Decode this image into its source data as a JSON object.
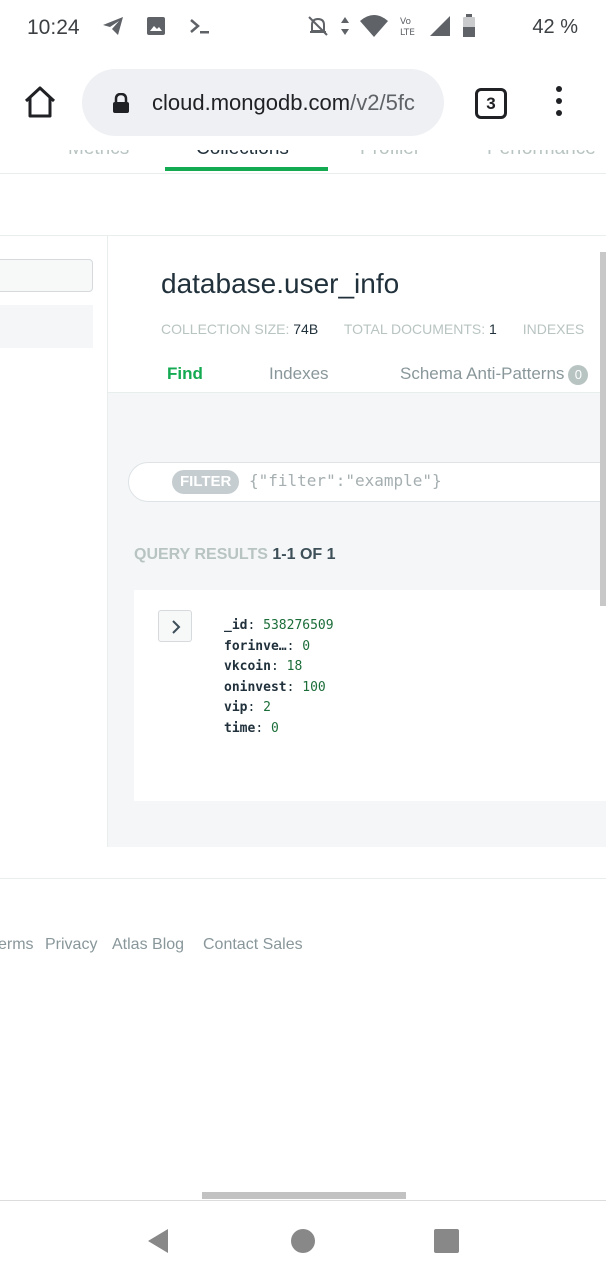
{
  "status_bar": {
    "time": "10:24",
    "battery_percent": "42 %",
    "icons_left": [
      "telegram-icon",
      "image-icon",
      "terminal-icon"
    ],
    "icons_right": [
      "mute-bell-icon",
      "data-arrows-icon",
      "wifi-icon",
      "volte-icon",
      "signal-icon",
      "battery-icon"
    ]
  },
  "browser": {
    "url_domain": "cloud.mongodb.com",
    "url_path": "/v2/5fc",
    "tab_count": "3"
  },
  "page_nav": {
    "items": [
      {
        "label": "Metrics",
        "active": false
      },
      {
        "label": "Collections",
        "active": true
      },
      {
        "label": "Profiler",
        "active": false
      },
      {
        "label": "Performance",
        "active": false
      }
    ]
  },
  "collection": {
    "title": "database.user_info",
    "stats": [
      {
        "label": "COLLECTION SIZE:",
        "value": "74B"
      },
      {
        "label": "TOTAL DOCUMENTS:",
        "value": "1"
      },
      {
        "label": "INDEXES",
        "value": ""
      }
    ],
    "tabs": [
      {
        "label": "Find",
        "active": true
      },
      {
        "label": "Indexes",
        "active": false
      },
      {
        "label": "Schema Anti-Patterns",
        "active": false,
        "badge": "0"
      }
    ]
  },
  "filter": {
    "pill": "FILTER",
    "placeholder": "{\"filter\":\"example\"}"
  },
  "query_results": {
    "label": "QUERY RESULTS",
    "count": "1-1 OF 1"
  },
  "document": {
    "fields": [
      {
        "key": "_id",
        "value": "538276509"
      },
      {
        "key": "forinve…",
        "value": "0"
      },
      {
        "key": "vkcoin",
        "value": "18"
      },
      {
        "key": "oninvest",
        "value": "100"
      },
      {
        "key": "vip",
        "value": "2"
      },
      {
        "key": "time",
        "value": "0"
      }
    ]
  },
  "footer": {
    "links": [
      "erms",
      "Privacy",
      "Atlas Blog",
      "Contact Sales"
    ]
  },
  "colors": {
    "accent_green": "#13aa52",
    "muted_gray": "#b8c4c2",
    "value_green": "#1b6d39"
  }
}
